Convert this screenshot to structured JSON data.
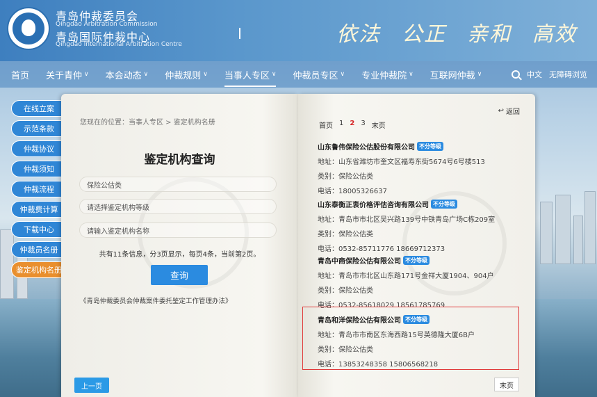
{
  "header": {
    "org_cn_1": "青岛仲裁委员会",
    "org_en_1": "Qingdao Arbitration Commission",
    "org_cn_2": "青岛国际仲裁中心",
    "org_en_2": "Qingdao International Arbitration Centre",
    "slogan": [
      "依法",
      "公正",
      "亲和",
      "高效"
    ]
  },
  "nav": {
    "items": [
      {
        "label": "首页",
        "chevron": false
      },
      {
        "label": "关于青仲",
        "chevron": true
      },
      {
        "label": "本会动态",
        "chevron": true
      },
      {
        "label": "仲裁规则",
        "chevron": true
      },
      {
        "label": "当事人专区",
        "chevron": true,
        "active": true
      },
      {
        "label": "仲裁员专区",
        "chevron": true
      },
      {
        "label": "专业仲裁院",
        "chevron": true
      },
      {
        "label": "互联网仲裁",
        "chevron": true
      }
    ],
    "lang": "中文",
    "accessibility": "无障碍浏览"
  },
  "sidebar": {
    "items": [
      {
        "label": "在线立案"
      },
      {
        "label": "示范条款"
      },
      {
        "label": "仲裁协议"
      },
      {
        "label": "仲裁须知"
      },
      {
        "label": "仲裁流程"
      },
      {
        "label": "仲裁费计算"
      },
      {
        "label": "下载中心"
      },
      {
        "label": "仲裁员名册"
      },
      {
        "label": "鉴定机构名册",
        "active": true
      }
    ]
  },
  "left_page": {
    "breadcrumb": "您现在的位置：当事人专区 > 鉴定机构名册",
    "title": "鉴定机构查询",
    "field_category": "保险公估类",
    "field_level_placeholder": "请选择鉴定机构等级",
    "field_name_placeholder": "请输入鉴定机构名称",
    "summary": "共有11条信息，分3页显示，每页4条，当前第2页。",
    "query_button": "查询",
    "law_link": "《青岛仲裁委员会仲裁案件委托鉴定工作管理办法》",
    "prev_button": "上一页"
  },
  "right_page": {
    "back": "返回",
    "pager": {
      "first": "首页",
      "pages": [
        "1",
        "2",
        "3"
      ],
      "current": "2",
      "last": "末页"
    },
    "entries": [
      {
        "name": "山东鲁伟保险公估股份有限公司",
        "badge": "不分等级",
        "address": "地址：山东省潍坊市奎文区福寿东街5674号6号楼513",
        "category": "类别：保险公估类",
        "phone": "电话：18005326637"
      },
      {
        "name": "山东泰衡正衷价格评估咨询有限公司",
        "badge": "不分等级",
        "address": "地址：青岛市市北区吴兴路139号中铁青岛广场C栋209室",
        "category": "类别：保险公估类",
        "phone": "电话：0532-85711776 18669712373"
      },
      {
        "name": "青岛中商保险公估有限公司",
        "badge": "不分等级",
        "address": "地址：青岛市市北区山东路171号金祥大厦1904、904户",
        "category": "类别：保险公估类",
        "phone": "电话：0532-85618029 18561785769"
      },
      {
        "name": "青岛和洋保险公估有限公司",
        "badge": "不分等级",
        "address": "地址：青岛市市南区东海西路15号英德隆大厦6B户",
        "category": "类别：保险公估类",
        "phone": "电话：13853248358 15806568218"
      }
    ],
    "last_button": "末页"
  },
  "colors": {
    "accent": "#2b8be0",
    "active_tab": "#e98f2e",
    "highlight": "#e03a3a"
  }
}
